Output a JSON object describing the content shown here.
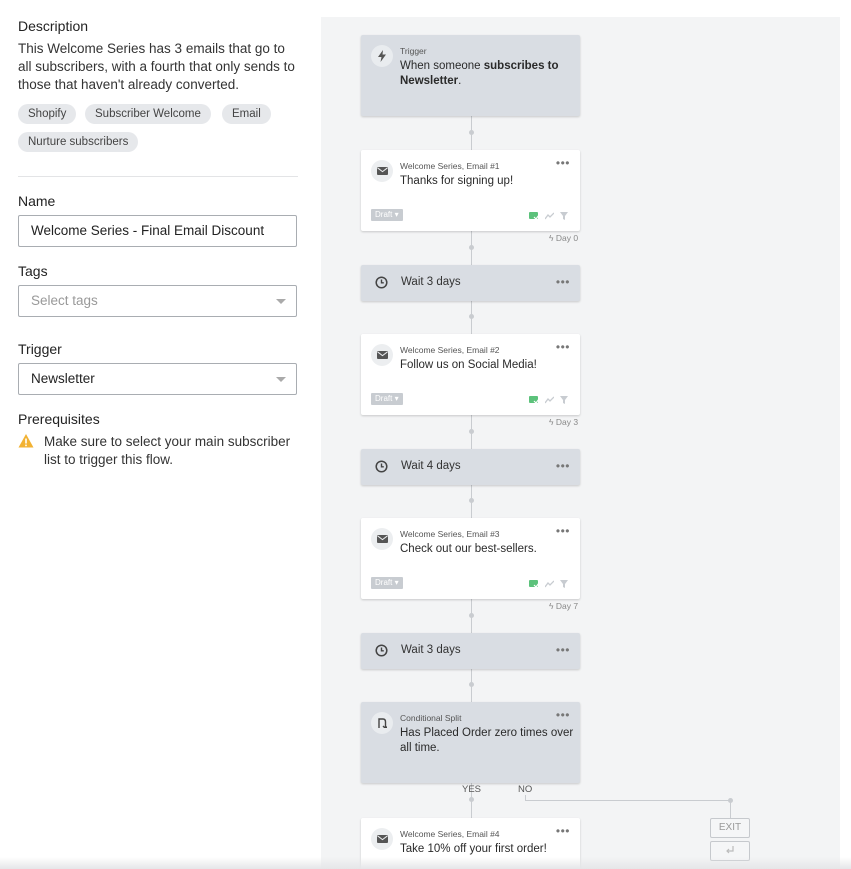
{
  "left": {
    "description_heading": "Description",
    "description_text": "This Welcome Series has 3 emails that go to all subscribers, with a fourth that only sends to those that haven't already converted.",
    "tags_pills": [
      "Shopify",
      "Subscriber Welcome",
      "Email",
      "Nurture subscribers"
    ],
    "name_label": "Name",
    "name_value": "Welcome Series - Final Email Discount",
    "tags_label": "Tags",
    "tags_placeholder": "Select tags",
    "trigger_label": "Trigger",
    "trigger_value": "Newsletter",
    "prereq_label": "Prerequisites",
    "prereq_text": "Make sure to select your main subscriber list to trigger this flow."
  },
  "flow": {
    "trigger": {
      "small": "Trigger",
      "text_pre": "When someone ",
      "text_bold": "subscribes to Newsletter",
      "text_post": "."
    },
    "email1": {
      "small": "Welcome Series, Email #1",
      "title": "Thanks for signing up!",
      "status": "Draft",
      "day": "Day 0"
    },
    "wait1": {
      "label": "Wait 3 days"
    },
    "email2": {
      "small": "Welcome Series, Email #2",
      "title": "Follow us on Social Media!",
      "status": "Draft",
      "day": "Day 3"
    },
    "wait2": {
      "label": "Wait 4 days"
    },
    "email3": {
      "small": "Welcome Series, Email #3",
      "title": "Check out our best-sellers.",
      "status": "Draft",
      "day": "Day 7"
    },
    "wait3": {
      "label": "Wait 3 days"
    },
    "split": {
      "small": "Conditional Split",
      "text": "Has Placed Order zero times over all time."
    },
    "yes_label": "YES",
    "no_label": "NO",
    "exit_label": "EXIT",
    "email4": {
      "small": "Welcome Series, Email #4",
      "title": "Take 10% off your first order!"
    },
    "menu_glyph": "•••"
  },
  "colors": {
    "accent_green": "#5cc27b",
    "warning": "#f2b233",
    "card_grey": "#d9dde3"
  }
}
